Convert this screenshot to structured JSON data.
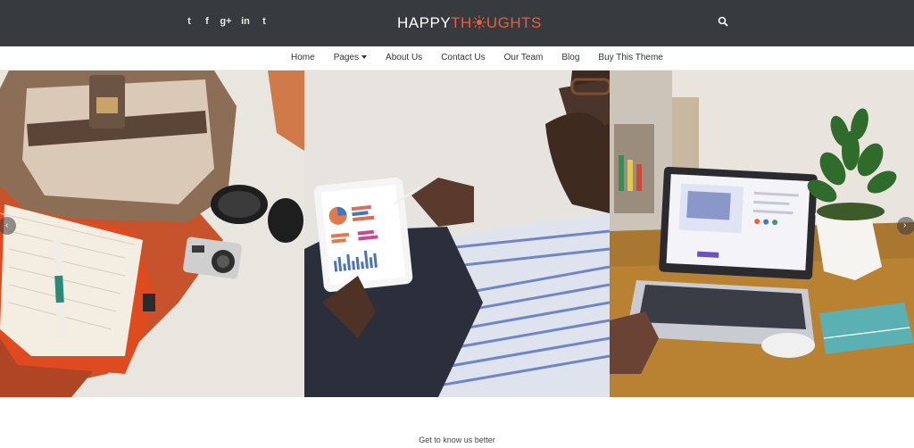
{
  "header": {
    "logo_part1": "HAPPY",
    "logo_part2a": "TH",
    "logo_part2b": "UGHTS",
    "social_icons": [
      "twitter-icon",
      "facebook-icon",
      "google-plus-icon",
      "linkedin-icon",
      "tumblr-icon"
    ],
    "social_glyphs": [
      "t",
      "f",
      "g+",
      "in",
      "t"
    ],
    "accent_color": "#e8603c",
    "bar_color": "#373a3f"
  },
  "nav": {
    "items": [
      {
        "label": "Home"
      },
      {
        "label": "Pages",
        "dropdown": true
      },
      {
        "label": "About Us"
      },
      {
        "label": "Contact Us"
      },
      {
        "label": "Our Team"
      },
      {
        "label": "Blog"
      },
      {
        "label": "Buy This Theme"
      }
    ]
  },
  "slider": {
    "prev_glyph": "‹",
    "next_glyph": "›",
    "slides": [
      "travel-flatlay-image",
      "tablet-analytics-image",
      "laptop-desk-image"
    ]
  },
  "section": {
    "subtitle": "Get to know us better"
  }
}
